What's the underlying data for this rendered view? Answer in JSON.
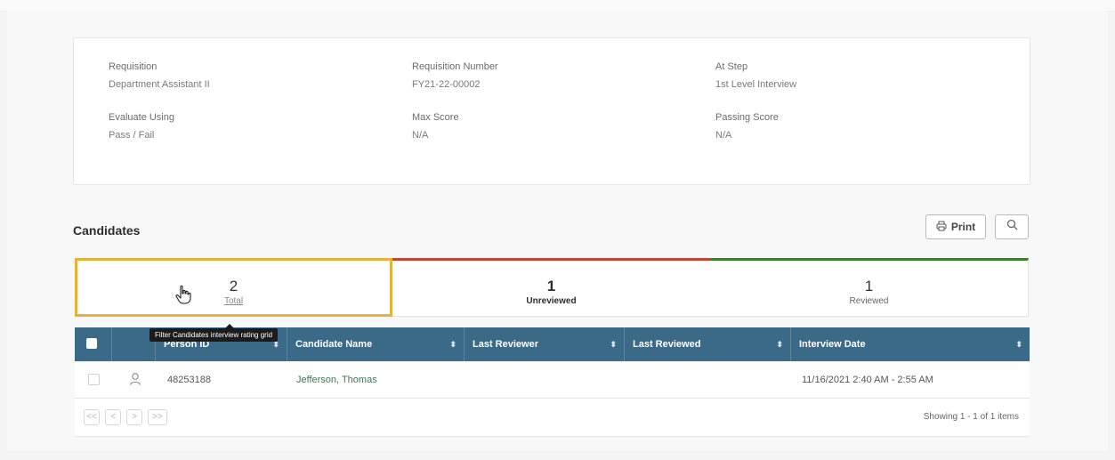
{
  "requisition_info": {
    "requisition": {
      "label": "Requisition",
      "value": "Department Assistant II"
    },
    "requisition_number": {
      "label": "Requisition Number",
      "value": "FY21-22-00002"
    },
    "at_step": {
      "label": "At Step",
      "value": "1st Level Interview"
    },
    "evaluate_using": {
      "label": "Evaluate Using",
      "value": "Pass / Fail"
    },
    "max_score": {
      "label": "Max Score",
      "value": "N/A"
    },
    "passing_score": {
      "label": "Passing Score",
      "value": "N/A"
    }
  },
  "candidates": {
    "title": "Candidates",
    "print_label": "Print",
    "search_icon": "search-icon",
    "print_icon": "printer-icon"
  },
  "stats": {
    "total": {
      "count": "2",
      "label": "Total",
      "color": "#e8b23a"
    },
    "unreviewed": {
      "count": "1",
      "label": "Unreviewed",
      "color": "#c3423a"
    },
    "reviewed": {
      "count": "1",
      "label": "Reviewed",
      "color": "#3f7f2b"
    }
  },
  "tooltip": "Filter Candidates interview rating grid",
  "grid": {
    "header_color": "#3b6a88",
    "columns": [
      "Person ID",
      "Candidate Name",
      "Last Reviewer",
      "Last Reviewed",
      "Interview Date"
    ],
    "rows": [
      {
        "person_id": "48253188",
        "candidate_name": "Jefferson, Thomas",
        "last_reviewer": "",
        "last_reviewed": "",
        "interview_date": "11/16/2021 2:40 AM - 2:55 AM"
      }
    ]
  },
  "pager": {
    "first": "<<",
    "prev": "<",
    "next": ">",
    "last": ">>",
    "showing_text": "Showing 1 - 1 of 1 items"
  }
}
